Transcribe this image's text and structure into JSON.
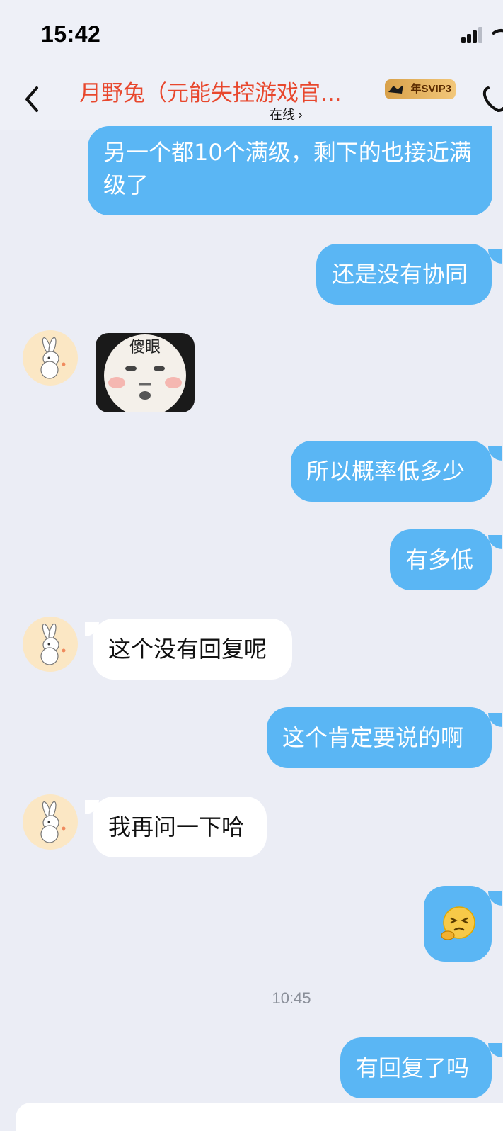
{
  "status_bar": {
    "time": "15:42"
  },
  "header": {
    "contact_name": "月野兔（元能失控游戏官...",
    "badge": "SVIP3",
    "badge_prefix": "年",
    "status": "在线",
    "status_chevron": "›"
  },
  "icons": {
    "back": "chevron-left-icon",
    "phone": "phone-icon",
    "signal": "signal-icon",
    "wifi": "wifi-icon"
  },
  "colors": {
    "outgoing_bubble": "#5ab6f4",
    "incoming_bubble": "#ffffff",
    "background": "#ebedf5",
    "contact_name": "#e8472d"
  },
  "messages": [
    {
      "direction": "out",
      "text": "另一个都10个满级，剩下的也接近满级了"
    },
    {
      "direction": "out",
      "text": "还是没有协同"
    },
    {
      "direction": "in",
      "type": "sticker",
      "caption": "傻眼"
    },
    {
      "direction": "out",
      "text": "所以概率低多少"
    },
    {
      "direction": "out",
      "text": "有多低"
    },
    {
      "direction": "in",
      "text": "这个没有回复呢"
    },
    {
      "direction": "out",
      "text": "这个肯定要说的啊"
    },
    {
      "direction": "in",
      "text": "我再问一下哈"
    },
    {
      "direction": "out",
      "type": "emoji",
      "emoji": "angry-thinking-emoji"
    },
    {
      "direction": "out",
      "text": "有回复了吗"
    }
  ],
  "timestamp": "10:45"
}
